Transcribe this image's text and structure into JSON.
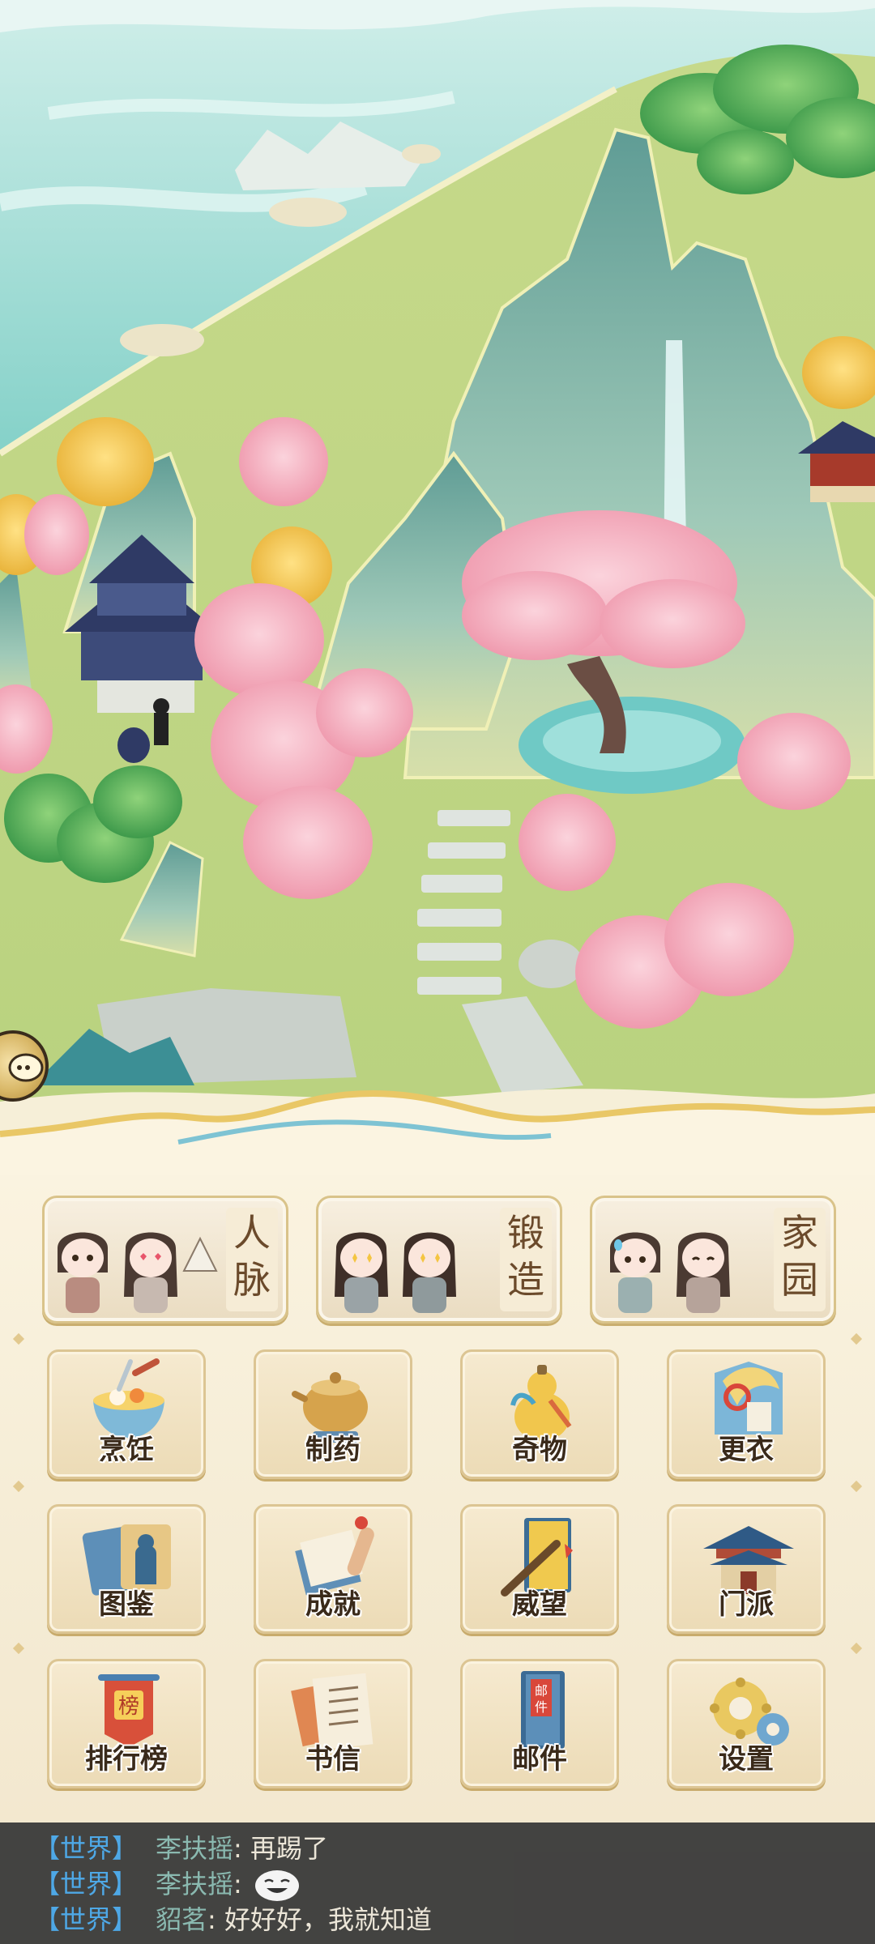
{
  "scene": {
    "landmarks": [
      {
        "name": "left-hall",
        "kind": "building"
      },
      {
        "name": "right-pavilion",
        "kind": "building"
      },
      {
        "name": "waterfall-pond",
        "kind": "water"
      },
      {
        "name": "stone-stairs",
        "kind": "path"
      }
    ]
  },
  "side_button": {
    "icon": "chat-bubble-icon"
  },
  "banners": [
    {
      "label": "人脉",
      "icon": "chibi-pair-icon"
    },
    {
      "label": "锻造",
      "icon": "chibi-pair-icon"
    },
    {
      "label": "家园",
      "icon": "chibi-pair-icon"
    }
  ],
  "grid": [
    {
      "label": "烹饪",
      "icon": "cooking-bowl-icon"
    },
    {
      "label": "制药",
      "icon": "medicine-pot-icon"
    },
    {
      "label": "奇物",
      "icon": "gourd-icon"
    },
    {
      "label": "更衣",
      "icon": "wardrobe-fan-icon"
    },
    {
      "label": "图鉴",
      "icon": "portrait-cards-icon"
    },
    {
      "label": "成就",
      "icon": "scroll-book-icon"
    },
    {
      "label": "威望",
      "icon": "brush-book-icon"
    },
    {
      "label": "门派",
      "icon": "temple-icon"
    },
    {
      "label": "排行榜",
      "icon": "ranking-banner-icon"
    },
    {
      "label": "书信",
      "icon": "letter-icon"
    },
    {
      "label": "邮件",
      "icon": "mail-book-icon"
    },
    {
      "label": "设置",
      "icon": "settings-gear-icon"
    }
  ],
  "chat": [
    {
      "channel": "【世界】",
      "sender": "李扶摇",
      "message": "再踢了",
      "emoji": false
    },
    {
      "channel": "【世界】",
      "sender": "李扶摇",
      "message": "",
      "emoji": true
    },
    {
      "channel": "【世界】",
      "sender": "貂茗",
      "message": "好好好，我就知道",
      "emoji": false
    }
  ],
  "colors": {
    "panel_bg": "#f5ecd5",
    "tile_border": "#dcc593",
    "label_text": "#3a2a1a",
    "chat_channel": "#4ea8e6",
    "chat_sender": "#8ab9b0",
    "chat_bg": "#343434"
  }
}
